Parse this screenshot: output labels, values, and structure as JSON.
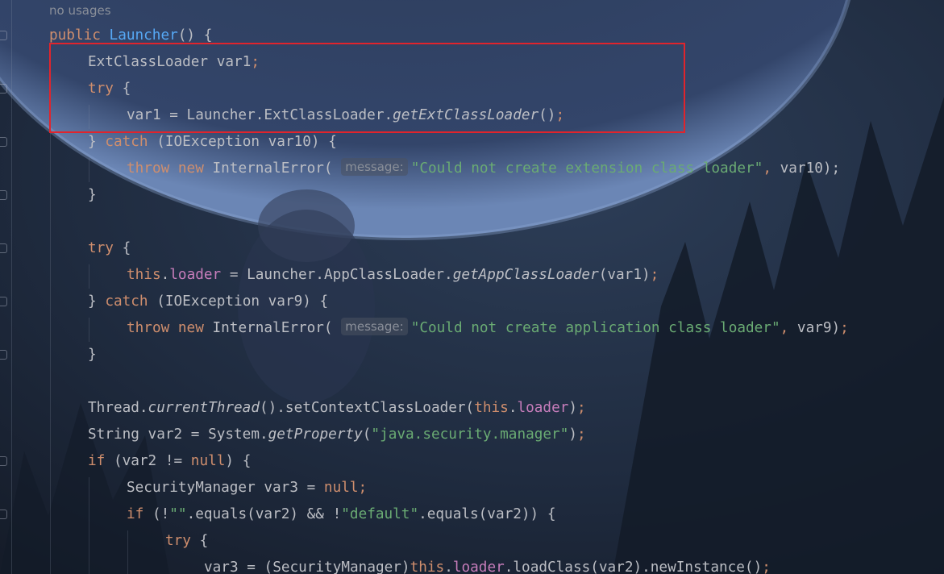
{
  "editor": {
    "usage_hint": "no usages",
    "param_hint": "message:",
    "highlight_color": "#e1242c",
    "colors": {
      "keyword": "#cf8e6d",
      "method_decl": "#56a8f5",
      "string": "#6aab73",
      "field": "#c77dbb",
      "plain": "#bcbec4"
    }
  },
  "lines": [
    [
      [
        "kw",
        "public "
      ],
      [
        "fn",
        "Launcher"
      ],
      [
        "",
        "() {"
      ]
    ],
    [
      [
        "",
        "ExtClassLoader var1"
      ],
      [
        "kw",
        ";"
      ]
    ],
    [
      [
        "kw",
        "try "
      ],
      [
        "",
        "{"
      ]
    ],
    [
      [
        "",
        "var1 = Launcher.ExtClassLoader."
      ],
      [
        "it",
        "getExtClassLoader"
      ],
      [
        "",
        "()"
      ],
      [
        "kw",
        ";"
      ]
    ],
    [
      [
        "",
        "} "
      ],
      [
        "kw",
        "catch "
      ],
      [
        "",
        "(IOException var10) {"
      ]
    ],
    [
      [
        "kw",
        "throw new "
      ],
      [
        "",
        "InternalError( "
      ],
      [
        "hint",
        "message:"
      ],
      [
        "str",
        "\"Could not create extension class loader\""
      ],
      [
        "kw",
        ","
      ],
      [
        "",
        " var10);"
      ]
    ],
    [
      [
        "",
        "}"
      ]
    ],
    [
      [
        "",
        ""
      ]
    ],
    [
      [
        "kw",
        "try "
      ],
      [
        "",
        "{"
      ]
    ],
    [
      [
        "kw",
        "this"
      ],
      [
        "",
        "."
      ],
      [
        "fld",
        "loader"
      ],
      [
        "",
        " = Launcher.AppClassLoader."
      ],
      [
        "it",
        "getAppClassLoader"
      ],
      [
        "",
        "(var1)"
      ],
      [
        "kw",
        ";"
      ]
    ],
    [
      [
        "",
        "} "
      ],
      [
        "kw",
        "catch "
      ],
      [
        "",
        "(IOException var9) {"
      ]
    ],
    [
      [
        "kw",
        "throw new "
      ],
      [
        "",
        "InternalError( "
      ],
      [
        "hint",
        "message:"
      ],
      [
        "str",
        "\"Could not create application class loader\""
      ],
      [
        "kw",
        ","
      ],
      [
        "",
        " var9)"
      ],
      [
        "kw",
        ";"
      ]
    ],
    [
      [
        "",
        "}"
      ]
    ],
    [
      [
        "",
        ""
      ]
    ],
    [
      [
        "",
        "Thread."
      ],
      [
        "it",
        "currentThread"
      ],
      [
        "",
        "().setContextClassLoader("
      ],
      [
        "kw",
        "this"
      ],
      [
        "",
        "."
      ],
      [
        "fld",
        "loader"
      ],
      [
        "",
        ")"
      ],
      [
        "kw",
        ";"
      ]
    ],
    [
      [
        "",
        "String var2 = System."
      ],
      [
        "it",
        "getProperty"
      ],
      [
        "",
        "("
      ],
      [
        "str",
        "\"java.security.manager\""
      ],
      [
        "",
        ")"
      ],
      [
        "kw",
        ";"
      ]
    ],
    [
      [
        "kw",
        "if "
      ],
      [
        "",
        "(var2 != "
      ],
      [
        "kw",
        "null"
      ],
      [
        "",
        ") {"
      ]
    ],
    [
      [
        "",
        "SecurityManager var3 = "
      ],
      [
        "kw",
        "null;"
      ]
    ],
    [
      [
        "kw",
        "if "
      ],
      [
        "",
        "(!"
      ],
      [
        "str",
        "\"\""
      ],
      [
        "",
        ".equals(var2) && !"
      ],
      [
        "str",
        "\"default\""
      ],
      [
        "",
        ".equals(var2)) {"
      ]
    ],
    [
      [
        "kw",
        "try "
      ],
      [
        "",
        "{"
      ]
    ],
    [
      [
        "",
        "var3 = (SecurityManager)"
      ],
      [
        "kw",
        "this"
      ],
      [
        "",
        "."
      ],
      [
        "fld",
        "loader"
      ],
      [
        "",
        ".loadClass(var2).newInstance()"
      ],
      [
        "kw",
        ";"
      ]
    ]
  ]
}
